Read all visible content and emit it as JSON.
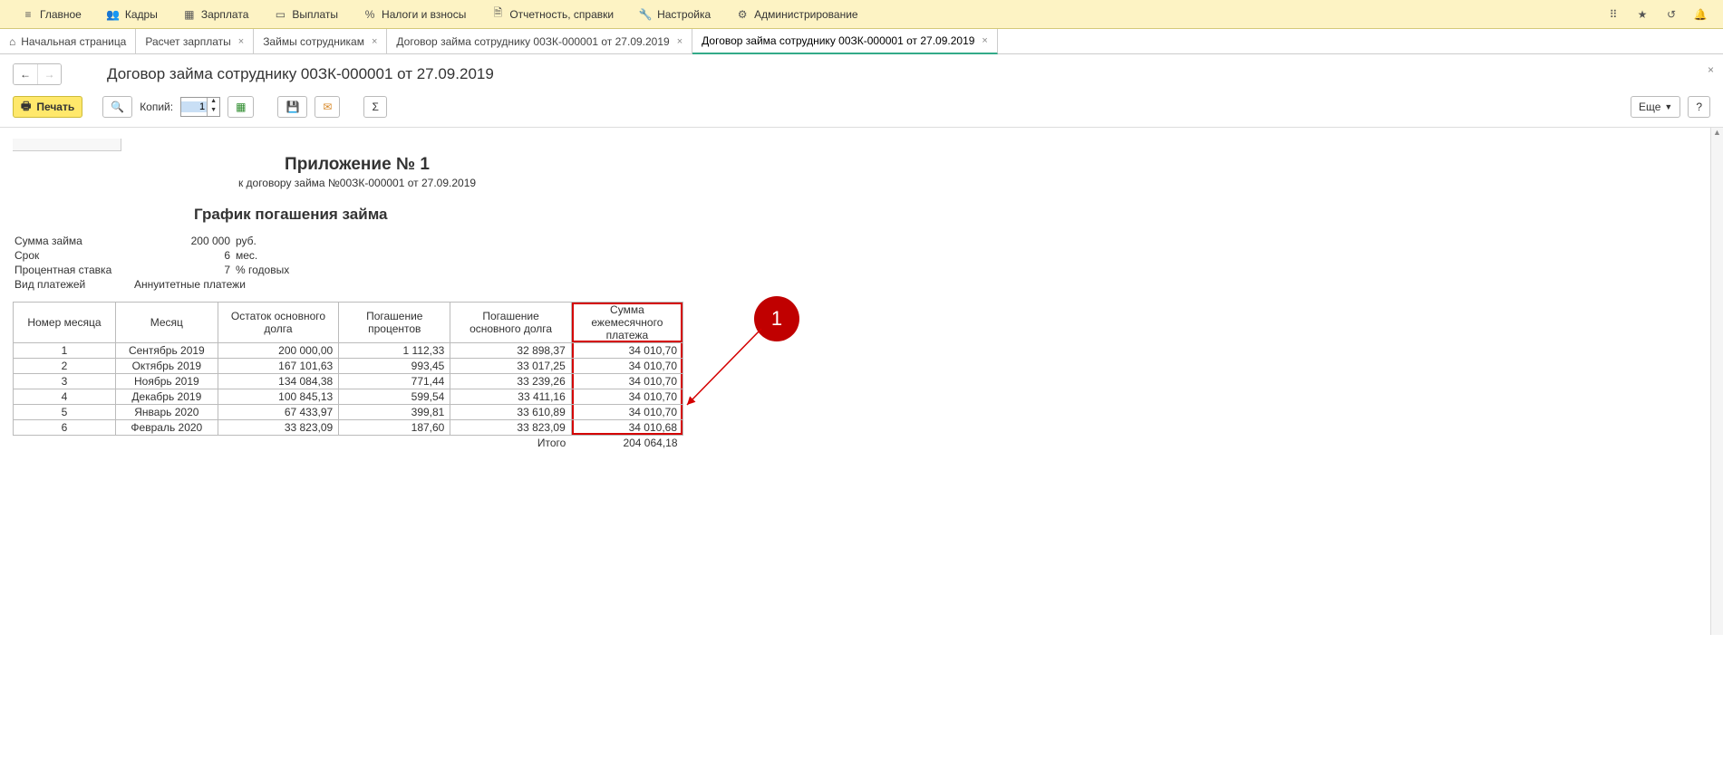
{
  "menu": {
    "items": [
      {
        "label": "Главное",
        "icon": "menu"
      },
      {
        "label": "Кадры",
        "icon": "people"
      },
      {
        "label": "Зарплата",
        "icon": "calendar"
      },
      {
        "label": "Выплаты",
        "icon": "wallet"
      },
      {
        "label": "Налоги и взносы",
        "icon": "percent"
      },
      {
        "label": "Отчетность, справки",
        "icon": "report"
      },
      {
        "label": "Настройка",
        "icon": "wrench"
      },
      {
        "label": "Администрирование",
        "icon": "gear"
      }
    ]
  },
  "tabs": [
    {
      "label": "Начальная страница",
      "icon": "home",
      "closable": false
    },
    {
      "label": "Расчет зарплаты",
      "closable": true
    },
    {
      "label": "Займы сотрудникам",
      "closable": true
    },
    {
      "label": "Договор займа сотруднику 00ЗК-000001 от 27.09.2019",
      "closable": true
    },
    {
      "label": "Договор займа сотруднику 00ЗК-000001 от 27.09.2019",
      "closable": true,
      "active": true
    }
  ],
  "page": {
    "title": "Договор займа сотруднику 00ЗК-000001 от 27.09.2019"
  },
  "toolbar": {
    "print": "Печать",
    "copies_label": "Копий:",
    "copies_value": "1",
    "more": "Еще",
    "help": "?"
  },
  "doc": {
    "title": "Приложение № 1",
    "subtitle": "к договору займа №00ЗК-000001 от 27.09.2019",
    "section": "График погашения займа",
    "params": {
      "sum_label": "Сумма займа",
      "sum_value": "200 000",
      "sum_unit": "руб.",
      "term_label": "Срок",
      "term_value": "6",
      "term_unit": "мес.",
      "rate_label": "Процентная ставка",
      "rate_value": "7",
      "rate_unit": "% годовых",
      "ptype_label": "Вид платежей",
      "ptype_value": "Аннуитетные платежи"
    },
    "headers": {
      "col1": "Номер месяца",
      "col2": "Месяц",
      "col3": "Остаток основного долга",
      "col4": "Погашение процентов",
      "col5": "Погашение основного долга",
      "col6": "Сумма ежемесячного платежа"
    },
    "rows": [
      {
        "n": "1",
        "month": "Сентябрь 2019",
        "rest": "200 000,00",
        "interest": "1 112,33",
        "principal": "32 898,37",
        "payment": "34 010,70"
      },
      {
        "n": "2",
        "month": "Октябрь 2019",
        "rest": "167 101,63",
        "interest": "993,45",
        "principal": "33 017,25",
        "payment": "34 010,70"
      },
      {
        "n": "3",
        "month": "Ноябрь 2019",
        "rest": "134 084,38",
        "interest": "771,44",
        "principal": "33 239,26",
        "payment": "34 010,70"
      },
      {
        "n": "4",
        "month": "Декабрь 2019",
        "rest": "100 845,13",
        "interest": "599,54",
        "principal": "33 411,16",
        "payment": "34 010,70"
      },
      {
        "n": "5",
        "month": "Январь 2020",
        "rest": "67 433,97",
        "interest": "399,81",
        "principal": "33 610,89",
        "payment": "34 010,70"
      },
      {
        "n": "6",
        "month": "Февраль 2020",
        "rest": "33 823,09",
        "interest": "187,60",
        "principal": "33 823,09",
        "payment": "34 010,68"
      }
    ],
    "total_label": "Итого",
    "total_value": "204 064,18"
  },
  "callout": {
    "num": "1"
  }
}
